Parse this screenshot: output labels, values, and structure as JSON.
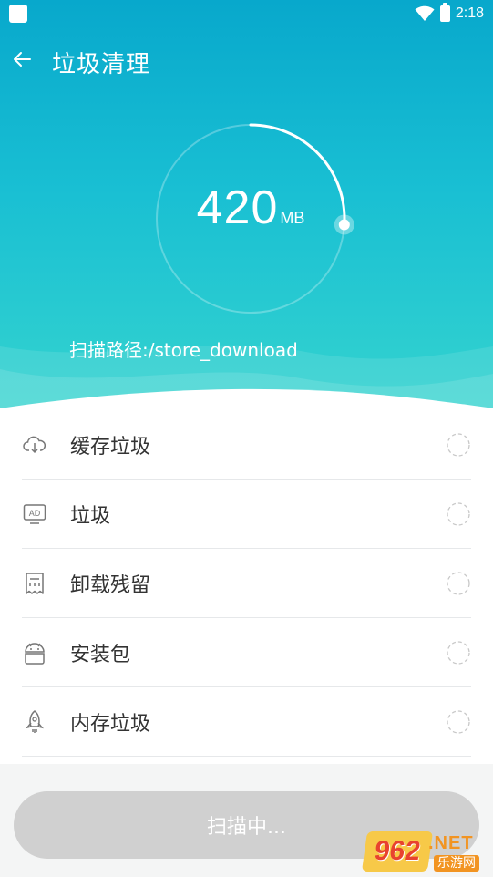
{
  "status_bar": {
    "time": "2:18"
  },
  "app_bar": {
    "title": "垃圾清理"
  },
  "gauge": {
    "value": "420",
    "unit": "MB",
    "progress": 0.26
  },
  "scan_path": "扫描路径:/store_download",
  "categories": [
    {
      "label": "缓存垃圾",
      "icon": "cloud-download-icon"
    },
    {
      "label": "垃圾",
      "icon": "ad-icon"
    },
    {
      "label": "卸载残留",
      "icon": "uninstall-residue-icon"
    },
    {
      "label": "安装包",
      "icon": "android-apk-icon"
    },
    {
      "label": "内存垃圾",
      "icon": "rocket-icon"
    }
  ],
  "scan_button": {
    "label": "扫描中..."
  },
  "watermark": {
    "number": "962",
    "domain": ".NET",
    "site": "乐游网"
  },
  "colors": {
    "accent_top": "#08a8cc",
    "accent_bottom": "#35d4cf",
    "button_disabled": "#d0d0d0"
  }
}
